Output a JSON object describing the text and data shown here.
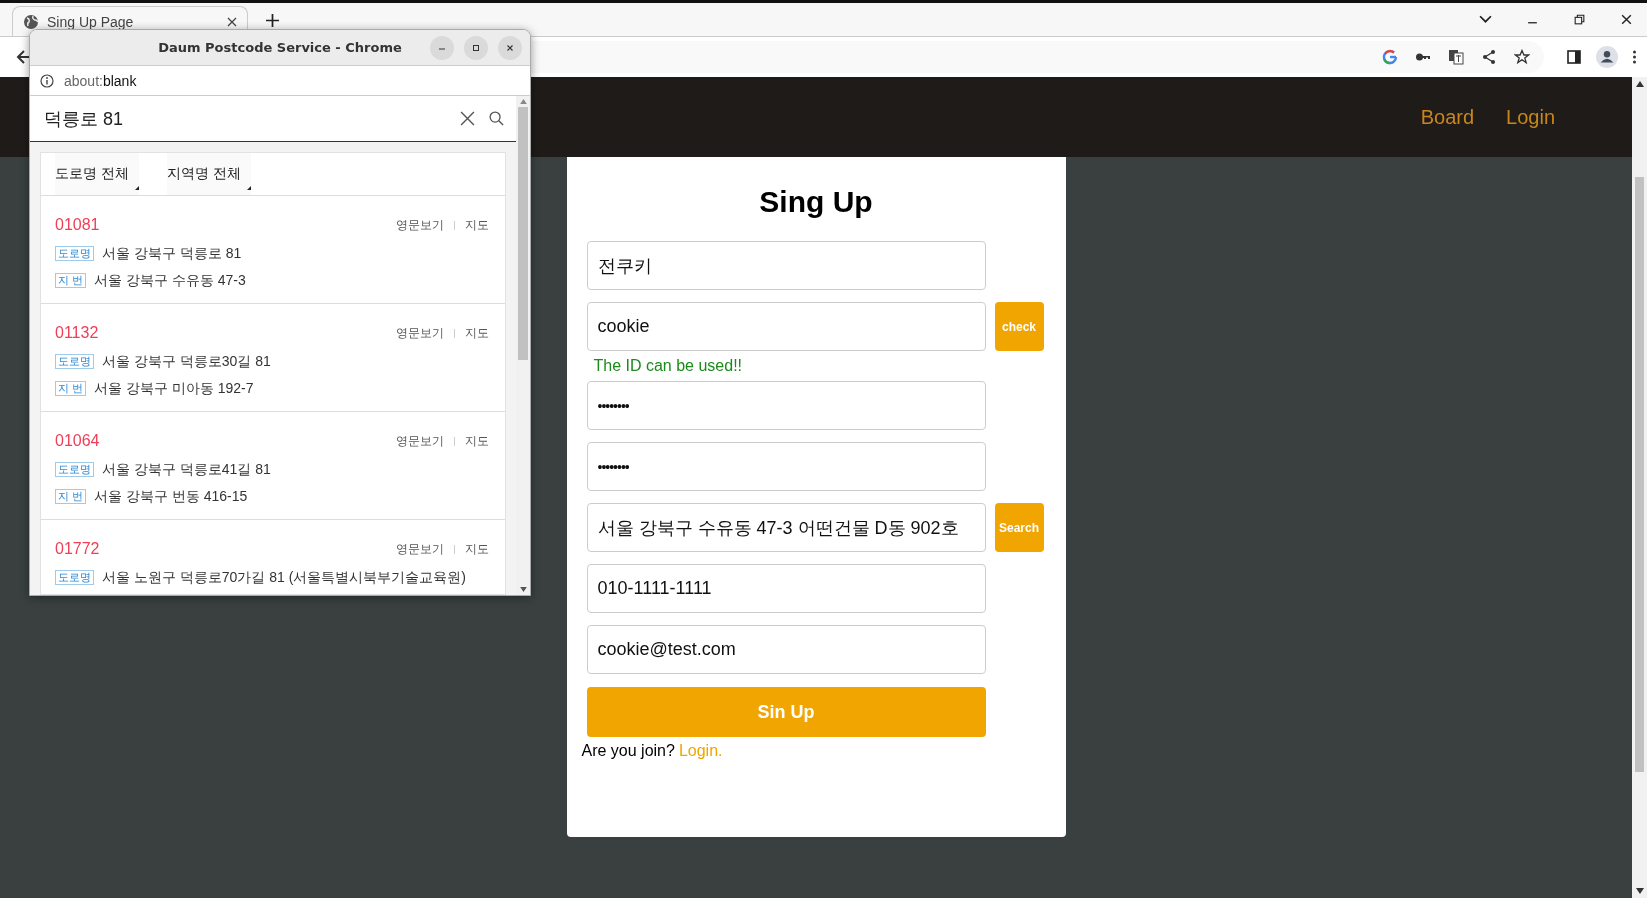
{
  "browser": {
    "tab_title": "Sing Up Page"
  },
  "navbar": {
    "links": [
      "Board",
      "Login"
    ]
  },
  "form": {
    "title": "Sing Up",
    "fields": [
      {
        "kind": "text",
        "value": "전쿠키"
      },
      {
        "kind": "text",
        "value": "cookie",
        "button": "check",
        "message": "The ID can be used!!"
      },
      {
        "kind": "password",
        "value": "••••••••"
      },
      {
        "kind": "password",
        "value": "••••••••"
      },
      {
        "kind": "text",
        "value": "서울 강북구 수유동 47-3 어떤건물 D동 902호",
        "button": "Search"
      },
      {
        "kind": "text",
        "value": "010-1111-1111"
      },
      {
        "kind": "text",
        "value": "cookie@test.com"
      }
    ],
    "submit": "Sin Up",
    "footer_text": "Are you join?",
    "footer_link": "Login."
  },
  "popup": {
    "title": "Daum Postcode Service - Chrome",
    "url_scheme": "about:",
    "url_path": "blank",
    "search": {
      "value": "덕릉로 81"
    },
    "filters": [
      "도로명 전체",
      "지역명 전체"
    ],
    "results": [
      {
        "postcode": "01081",
        "links": [
          "영문보기",
          "지도"
        ],
        "lines": [
          {
            "tag": "도로명",
            "address": "서울 강북구 덕릉로 81"
          },
          {
            "tag": "지 번",
            "address": "서울 강북구 수유동 47-3"
          }
        ]
      },
      {
        "postcode": "01132",
        "links": [
          "영문보기",
          "지도"
        ],
        "lines": [
          {
            "tag": "도로명",
            "address": "서울 강북구 덕릉로30길 81"
          },
          {
            "tag": "지 번",
            "address": "서울 강북구 미아동 192-7"
          }
        ]
      },
      {
        "postcode": "01064",
        "links": [
          "영문보기",
          "지도"
        ],
        "lines": [
          {
            "tag": "도로명",
            "address": "서울 강북구 덕릉로41길 81"
          },
          {
            "tag": "지 번",
            "address": "서울 강북구 번동 416-15"
          }
        ]
      },
      {
        "postcode": "01772",
        "links": [
          "영문보기",
          "지도"
        ],
        "lines": [
          {
            "tag": "도로명",
            "address": "서울 노원구 덕릉로70가길 81 (서울특별시북부기술교육원)"
          }
        ]
      }
    ]
  }
}
